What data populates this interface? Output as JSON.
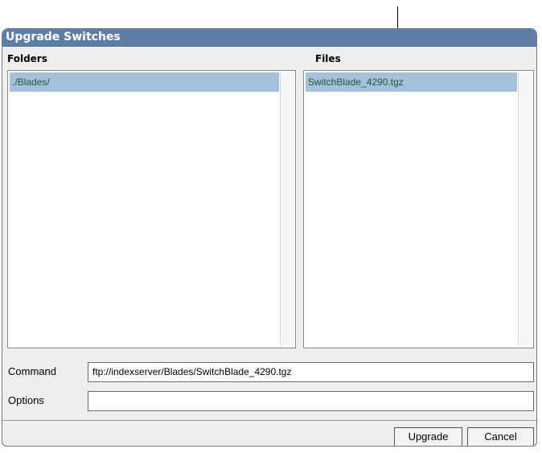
{
  "dialog": {
    "title": "Upgrade Switches"
  },
  "folders": {
    "label": "Folders",
    "items": [
      "./Blades/"
    ],
    "selected": "./Blades/"
  },
  "files": {
    "label": "Files",
    "items": [
      "SwitchBlade_4290.tgz"
    ],
    "selected": "SwitchBlade_4290.tgz"
  },
  "form": {
    "command_label": "Command",
    "command_value": "ftp://indexserver/Blades/SwitchBlade_4290.tgz",
    "options_label": "Options",
    "options_value": ""
  },
  "buttons": {
    "upgrade": "Upgrade",
    "cancel": "Cancel"
  },
  "colors": {
    "titlebar": "#5d7fa6",
    "selection": "#a4c0dc",
    "item_text": "#1c5b35"
  }
}
